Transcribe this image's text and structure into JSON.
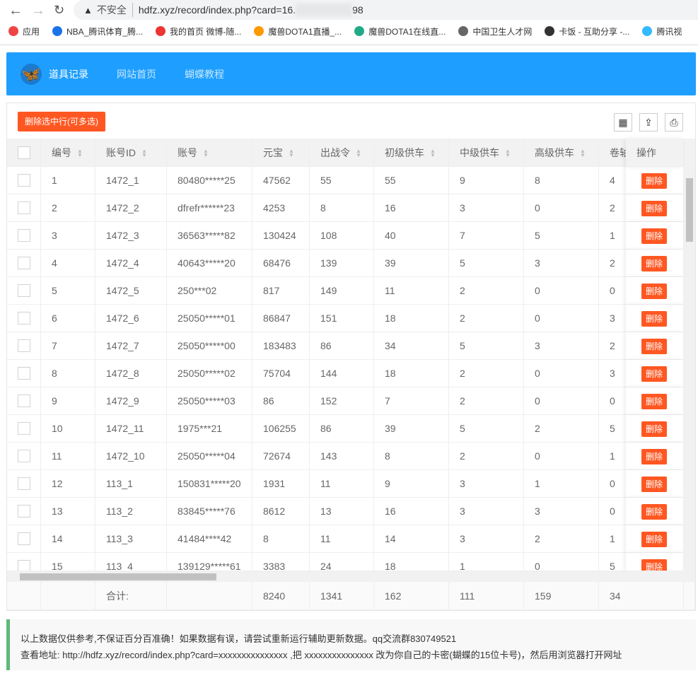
{
  "browser": {
    "insecure_label": "不安全",
    "url_prefix": "hdfz.xyz/record/index.php?card=16.",
    "url_suffix": "98",
    "bookmarks": [
      "应用",
      "NBA_腾讯体育_腾...",
      "我的首页 微博-随...",
      "魔兽DOTA1直播_...",
      "魔兽DOTA1在线直...",
      "中国卫生人才网",
      "卡饭 - 互助分享 -...",
      "腾讯视"
    ]
  },
  "nav": {
    "items": [
      "道具记录",
      "网站首页",
      "蝴蝶教程"
    ]
  },
  "toolbar": {
    "delete_selected": "删除选中行(可多选)"
  },
  "table": {
    "columns": [
      "编号",
      "账号ID",
      "账号",
      "元宝",
      "出战令",
      "初级供车",
      "中级供车",
      "高级供车",
      "卷轴"
    ],
    "action_header": "操作",
    "delete_label": "删除",
    "rows": [
      [
        "1",
        "1472_1",
        "80480*****25",
        "47562",
        "55",
        "55",
        "9",
        "8",
        "4"
      ],
      [
        "2",
        "1472_2",
        "dfrefr******23",
        "4253",
        "8",
        "16",
        "3",
        "0",
        "2"
      ],
      [
        "3",
        "1472_3",
        "36563*****82",
        "130424",
        "108",
        "40",
        "7",
        "5",
        "1"
      ],
      [
        "4",
        "1472_4",
        "40643*****20",
        "68476",
        "139",
        "39",
        "5",
        "3",
        "2"
      ],
      [
        "5",
        "1472_5",
        "250***02",
        "817",
        "149",
        "11",
        "2",
        "0",
        "0"
      ],
      [
        "6",
        "1472_6",
        "25050*****01",
        "86847",
        "151",
        "18",
        "2",
        "0",
        "3"
      ],
      [
        "7",
        "1472_7",
        "25050*****00",
        "183483",
        "86",
        "34",
        "5",
        "3",
        "2"
      ],
      [
        "8",
        "1472_8",
        "25050*****02",
        "75704",
        "144",
        "18",
        "2",
        "0",
        "3"
      ],
      [
        "9",
        "1472_9",
        "25050*****03",
        "86",
        "152",
        "7",
        "2",
        "0",
        "0"
      ],
      [
        "10",
        "1472_11",
        "1975***21",
        "106255",
        "86",
        "39",
        "5",
        "2",
        "5"
      ],
      [
        "11",
        "1472_10",
        "25050*****04",
        "72674",
        "143",
        "8",
        "2",
        "0",
        "1"
      ],
      [
        "12",
        "113_1",
        "150831*****20",
        "1931",
        "11",
        "9",
        "3",
        "1",
        "0"
      ],
      [
        "13",
        "113_2",
        "83845*****76",
        "8612",
        "13",
        "16",
        "3",
        "3",
        "0"
      ],
      [
        "14",
        "113_3",
        "41484****42",
        "8",
        "11",
        "14",
        "3",
        "2",
        "1"
      ],
      [
        "15",
        "113_4",
        "139129*****61",
        "3383",
        "24",
        "18",
        "1",
        "0",
        "5"
      ]
    ],
    "totals": [
      "",
      "",
      "合计:",
      "",
      "8240",
      "1341",
      "162",
      "111",
      "159",
      "34"
    ]
  },
  "notice": {
    "line1": "以上数据仅供参考,不保证百分百准确！如果数据有误，请尝试重新运行辅助更新数据。qq交流群830749521",
    "line2": "查看地址: http://hdfz.xyz/record/index.php?card=xxxxxxxxxxxxxxx ,把 xxxxxxxxxxxxxxx 改为你自己的卡密(蝴蝶的15位卡号)，然后用浏览器打开网址"
  },
  "colors": {
    "header": "#1e9fff",
    "danger": "#ff5722",
    "notice_border": "#5fb878"
  }
}
